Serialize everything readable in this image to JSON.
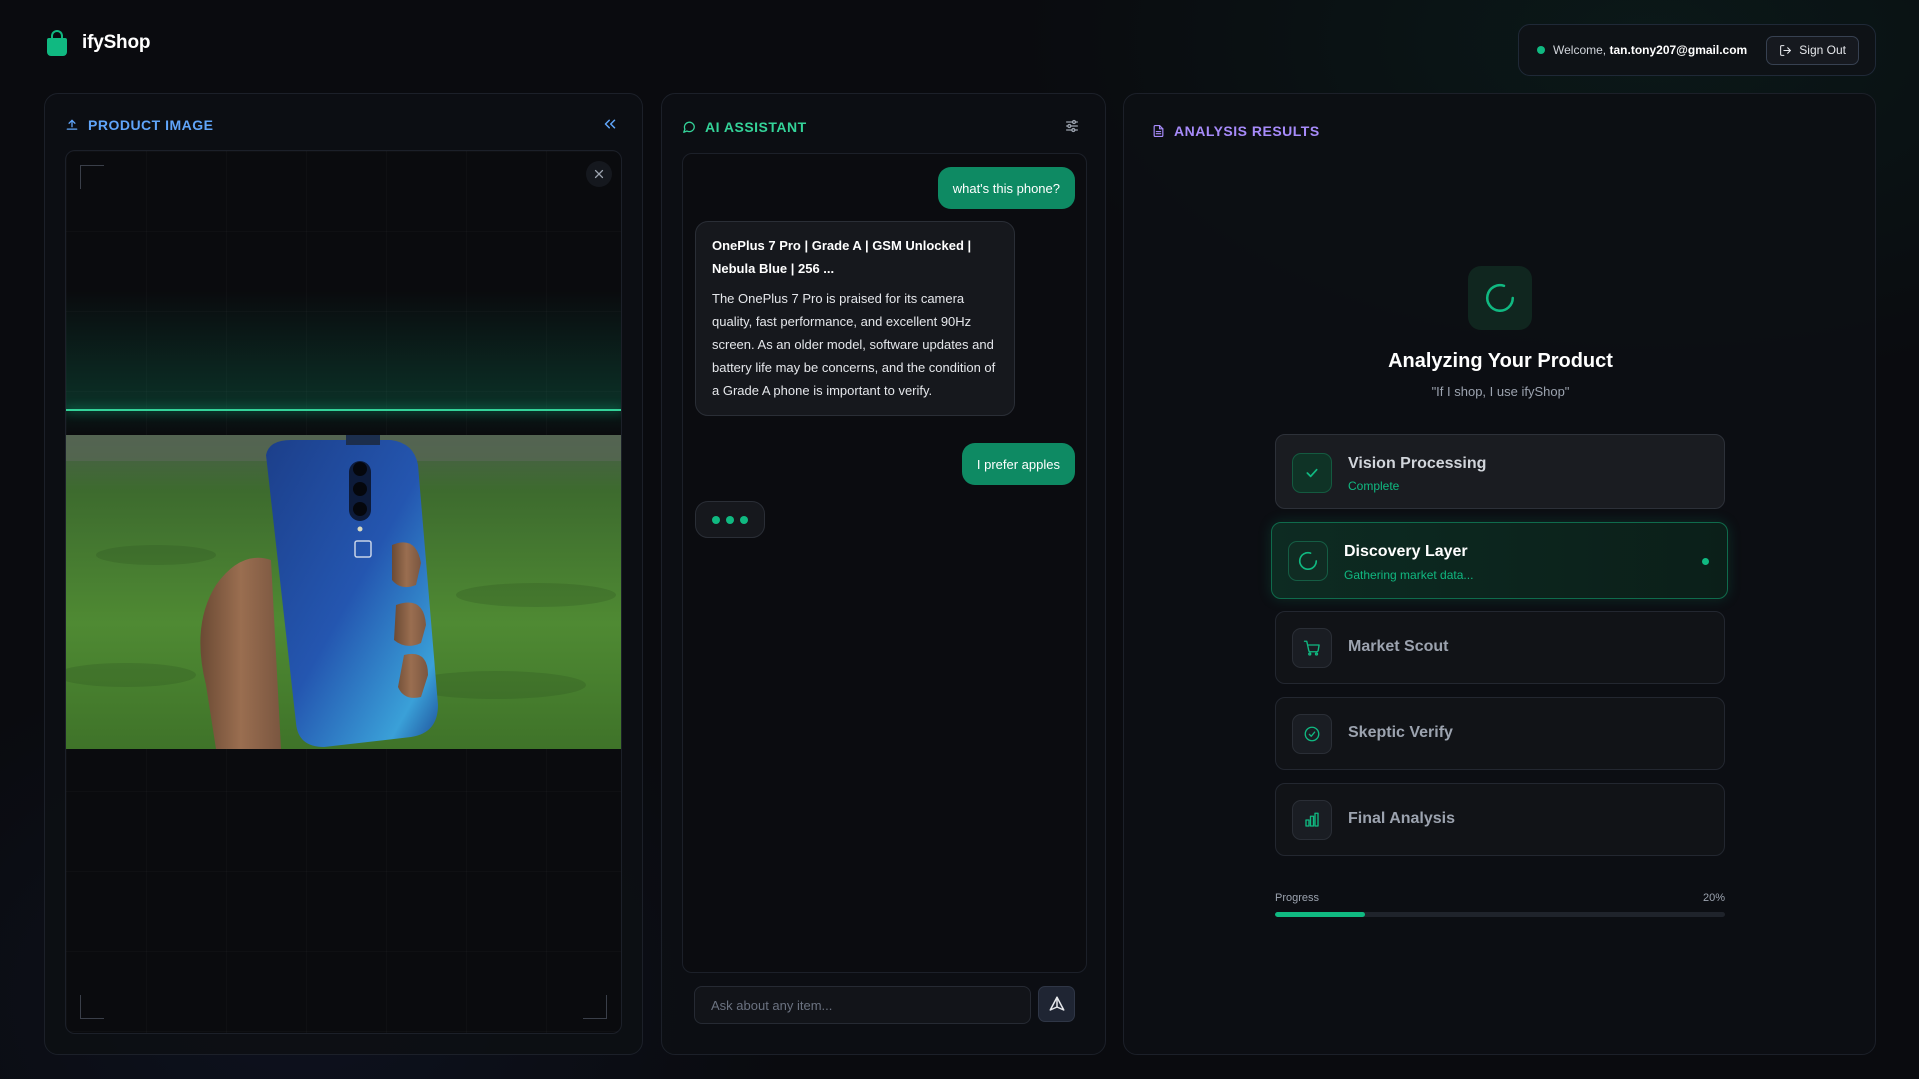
{
  "app": {
    "name": "ifyShop"
  },
  "header": {
    "welcome_prefix": "Welcome,",
    "user_email": "tan.tony207@gmail.com",
    "sign_out_label": "Sign Out"
  },
  "product_panel": {
    "title": "PRODUCT IMAGE",
    "photo_alt": "Hand holding a blue OnePlus phone over a grassy field"
  },
  "assistant_panel": {
    "title": "AI ASSISTANT",
    "messages": [
      {
        "role": "user",
        "text": "what's this phone?"
      },
      {
        "role": "assistant",
        "title": "OnePlus 7 Pro | Grade A | GSM Unlocked | Nebula Blue | 256 ...",
        "text": "The OnePlus 7 Pro is praised for its camera quality, fast performance, and excellent 90Hz screen. As an older model, software updates and battery life may be concerns, and the condition of a Grade A phone is important to verify."
      },
      {
        "role": "user",
        "text": "I prefer apples"
      }
    ],
    "input_placeholder": "Ask about any item..."
  },
  "analysis_panel": {
    "title": "ANALYSIS RESULTS",
    "heading": "Analyzing Your Product",
    "quote": "\"If I shop, I use ifyShop\"",
    "steps": [
      {
        "name": "Vision Processing",
        "status": "Complete",
        "state": "done",
        "icon": "check-icon"
      },
      {
        "name": "Discovery Layer",
        "status": "Gathering market data...",
        "state": "active",
        "icon": "spinner-icon"
      },
      {
        "name": "Market Scout",
        "state": "pending",
        "icon": "cart-icon"
      },
      {
        "name": "Skeptic Verify",
        "state": "pending",
        "icon": "check-circle-icon"
      },
      {
        "name": "Final Analysis",
        "state": "pending",
        "icon": "bar-chart-icon"
      }
    ],
    "progress_label": "Progress",
    "progress_value": "20%",
    "progress_fraction": 0.2
  },
  "colors": {
    "accent_green": "#10b981",
    "user_bubble": "#0e8a63",
    "product_title": "#60a5fa",
    "assistant_title": "#34d399",
    "analysis_title": "#a78bfa"
  }
}
